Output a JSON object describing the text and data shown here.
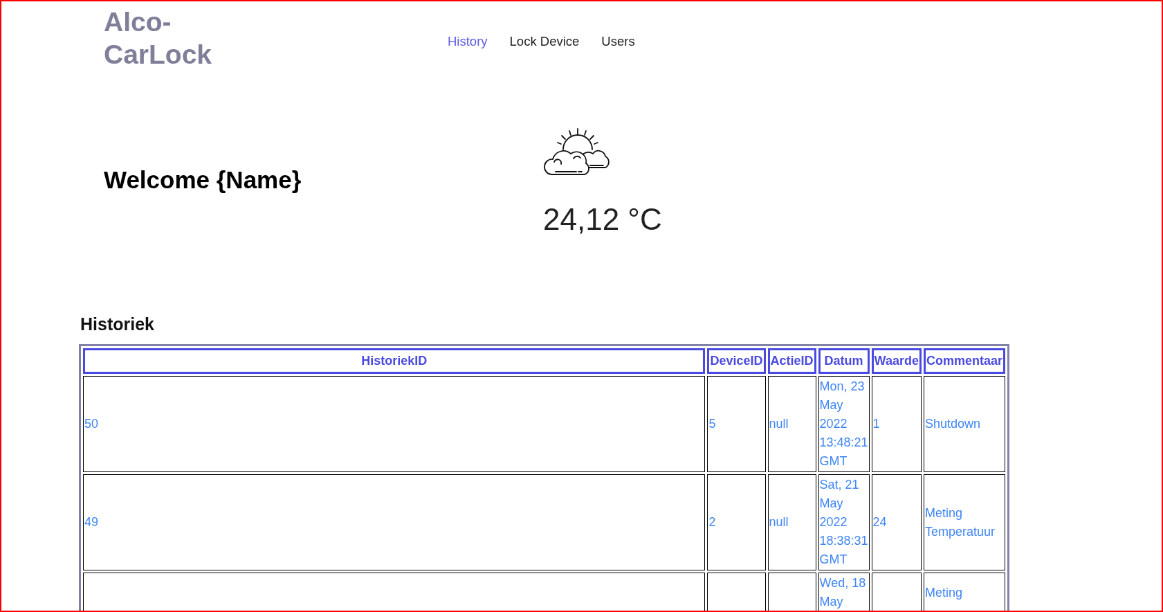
{
  "logo": "Alco-CarLock",
  "nav": [
    {
      "label": "History",
      "selected": true
    },
    {
      "label": "Lock Device",
      "selected": false
    },
    {
      "label": "Users",
      "selected": false
    }
  ],
  "welcome": "Welcome {Name}",
  "weather": {
    "temperature": "24,12 °C"
  },
  "history": {
    "title": "Historiek",
    "columns": [
      "HistoriekID",
      "DeviceID",
      "ActieID",
      "Datum",
      "Waarde",
      "Commentaar"
    ],
    "rows": [
      {
        "cells": [
          "50",
          "5",
          "null",
          "Mon, 23 May 2022 13:48:21 GMT",
          "1",
          "Shutdown"
        ]
      },
      {
        "cells": [
          "49",
          "2",
          "null",
          "Sat, 21 May 2022 18:38:31 GMT",
          "24",
          "Meting Temperatuur"
        ]
      },
      {
        "cells": [
          "",
          "",
          "",
          "Wed, 18 May",
          "",
          "Meting"
        ]
      }
    ]
  }
}
